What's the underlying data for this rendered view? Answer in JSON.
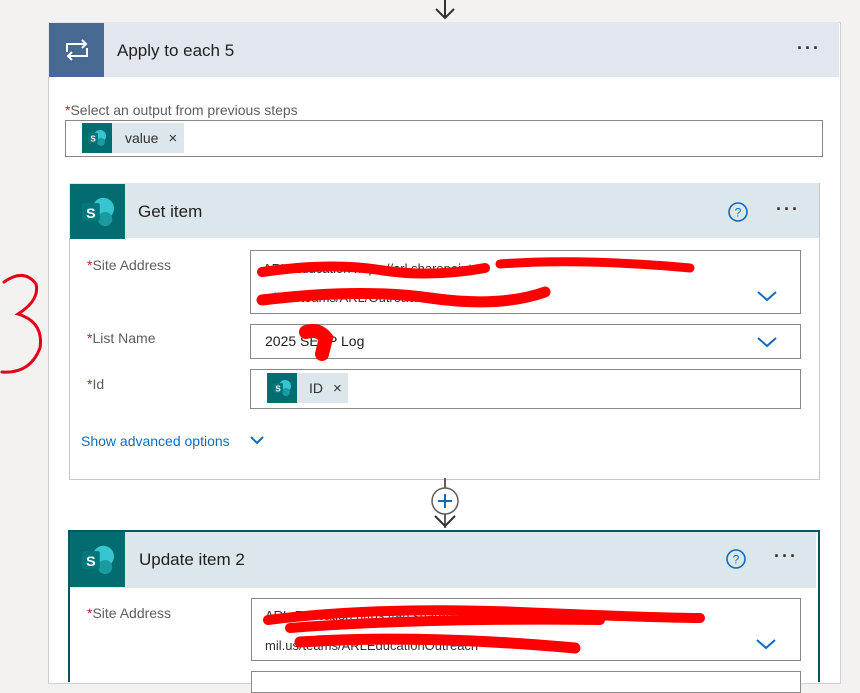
{
  "apply_each": {
    "title": "Apply to each 5",
    "select_label": "Select an output from previous steps",
    "token_label": "value",
    "remove": "×"
  },
  "get_item": {
    "title": "Get item",
    "site_address_label": "Site Address",
    "site_address_line1": "ARL-Education https://arl.sharepoint-",
    "site_address_line2": "mil.us/teams/ARL/OutreachSite",
    "list_name_label": "List Name",
    "list_name_value": "2025 SEEP Log",
    "id_label": "Id",
    "id_token": "ID",
    "remove": "×",
    "advanced": "Show advanced options"
  },
  "update_item": {
    "title": "Update item 2",
    "site_address_label": "Site Address",
    "site_address_line1": "ARL-Education https://arl.sharepoint-mil.us",
    "site_address_line2": "mil.us/teams/ARLEducationOutreach"
  },
  "annotation": {
    "mark": "3"
  },
  "icons": {
    "loop": "loop-icon",
    "sharepoint": "sharepoint-icon",
    "help": "help-icon",
    "more": "more-icon",
    "chevron": "chevron-down-icon",
    "add": "add-step-icon",
    "arrow": "arrow-down-icon"
  },
  "colors": {
    "loop_header": "#486991",
    "sharepoint": "#036c70",
    "card_header": "#dbe7ea",
    "accent": "#0f6cbd",
    "required": "#a4262c",
    "redaction": "#ff0000"
  }
}
